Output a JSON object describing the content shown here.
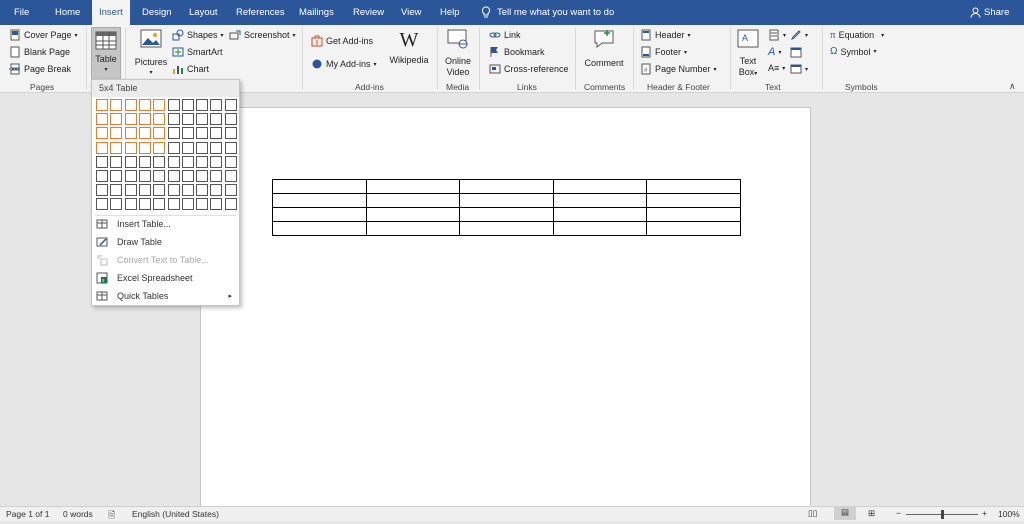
{
  "tabs": [
    "File",
    "Home",
    "Insert",
    "Design",
    "Layout",
    "References",
    "Mailings",
    "Review",
    "View",
    "Help"
  ],
  "active_tab": "Insert",
  "tell_me": "Tell me what you want to do",
  "share": "Share",
  "ribbon": {
    "pages": {
      "cover": "Cover Page",
      "blank": "Blank Page",
      "break": "Page Break",
      "label": "Pages"
    },
    "tables": {
      "table": "Table"
    },
    "illustrations": {
      "pictures": "Pictures",
      "shapes": "Shapes",
      "smartart": "SmartArt",
      "chart": "Chart",
      "screenshot": "Screenshot"
    },
    "addins": {
      "get": "Get Add-ins",
      "my": "My Add-ins",
      "wikipedia": "Wikipedia",
      "label": "Add-ins"
    },
    "media": {
      "online_video_1": "Online",
      "online_video_2": "Video",
      "label": "Media"
    },
    "links": {
      "link": "Link",
      "bookmark": "Bookmark",
      "cross": "Cross-reference",
      "label": "Links"
    },
    "comments": {
      "comment": "Comment",
      "label": "Comments"
    },
    "header_footer": {
      "header": "Header",
      "footer": "Footer",
      "page_number": "Page Number",
      "label": "Header & Footer"
    },
    "text": {
      "textbox_1": "Text",
      "textbox_2": "Box",
      "label": "Text"
    },
    "symbols": {
      "equation": "Equation",
      "symbol": "Symbol",
      "label": "Symbols"
    }
  },
  "dropdown": {
    "title": "5x4 Table",
    "grid_cols": 10,
    "grid_rows": 8,
    "selected_cols": 5,
    "selected_rows": 4,
    "items": [
      "Insert Table...",
      "Draw Table",
      "Convert Text to Table...",
      "Excel Spreadsheet",
      "Quick Tables"
    ]
  },
  "doc_table": {
    "rows": 4,
    "cols": 5
  },
  "status": {
    "page": "Page 1 of 1",
    "words": "0 words",
    "language": "English (United States)",
    "zoom": "100%"
  },
  "colors": {
    "accent": "#2b579a",
    "selection": "#e97a2e"
  }
}
